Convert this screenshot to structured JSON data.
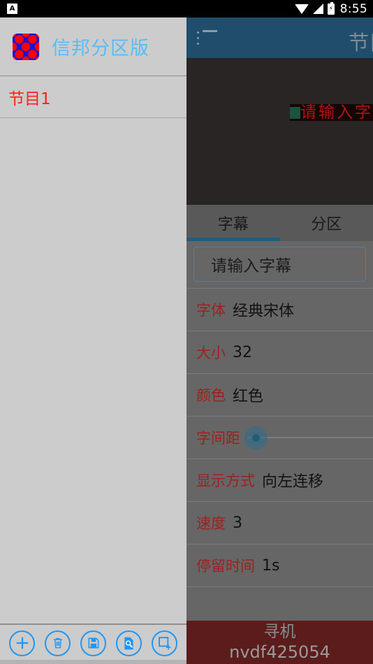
{
  "statusbar": {
    "app_icon": "app-badge-icon",
    "wifi_icon": "wifi-icon",
    "signal_icon": "cell-signal-icon",
    "battery_icon": "battery-charging-icon",
    "time": "8:55"
  },
  "drawer": {
    "app_icon": "app-logo-icon",
    "app_title": "信邦分区版",
    "items": [
      {
        "label": "节目1"
      }
    ],
    "actions": [
      {
        "name": "add-program-button",
        "icon": "plus-icon"
      },
      {
        "name": "delete-program-button",
        "icon": "trash-icon"
      },
      {
        "name": "save-program-button",
        "icon": "save-icon"
      },
      {
        "name": "preview-program-button",
        "icon": "document-search-icon"
      },
      {
        "name": "new-area-button",
        "icon": "add-frame-icon"
      }
    ]
  },
  "toolbar": {
    "menu_icon": "list-menu-icon",
    "title": "节目"
  },
  "preview": {
    "marker_color": "#16553e",
    "text": "请输入字幕",
    "text_color": "#b51212",
    "background": "#282524"
  },
  "tabs": [
    {
      "label": "字幕",
      "active": true
    },
    {
      "label": "分区",
      "active": false
    }
  ],
  "subtitle_input": {
    "value": "请输入字幕",
    "placeholder": "请输入字幕"
  },
  "settings": [
    {
      "label": "字体",
      "value": "经典宋体",
      "type": "text"
    },
    {
      "label": "大小",
      "value": "32",
      "type": "text"
    },
    {
      "label": "颜色",
      "value": "红色",
      "type": "text"
    },
    {
      "label": "字间距",
      "value": "0",
      "type": "slider"
    },
    {
      "label": "显示方式",
      "value": "向左连移",
      "type": "text"
    },
    {
      "label": "速度",
      "value": "3",
      "type": "text"
    },
    {
      "label": "停留时间",
      "value": "1s",
      "type": "text"
    }
  ],
  "banner": {
    "title": "寻机",
    "subtitle": "nvdf425054"
  },
  "colors": {
    "toolbar": "#1f4d6b",
    "accent": "#1f5d7e",
    "drawer_bg": "#cccccc",
    "panel_bg": "#666666",
    "label_red": "#9e2020",
    "item_red": "#ff1e1e",
    "app_title_blue": "#58bdf5",
    "banner_bg": "#5c1c1c",
    "icon_blue": "#2196f3"
  }
}
